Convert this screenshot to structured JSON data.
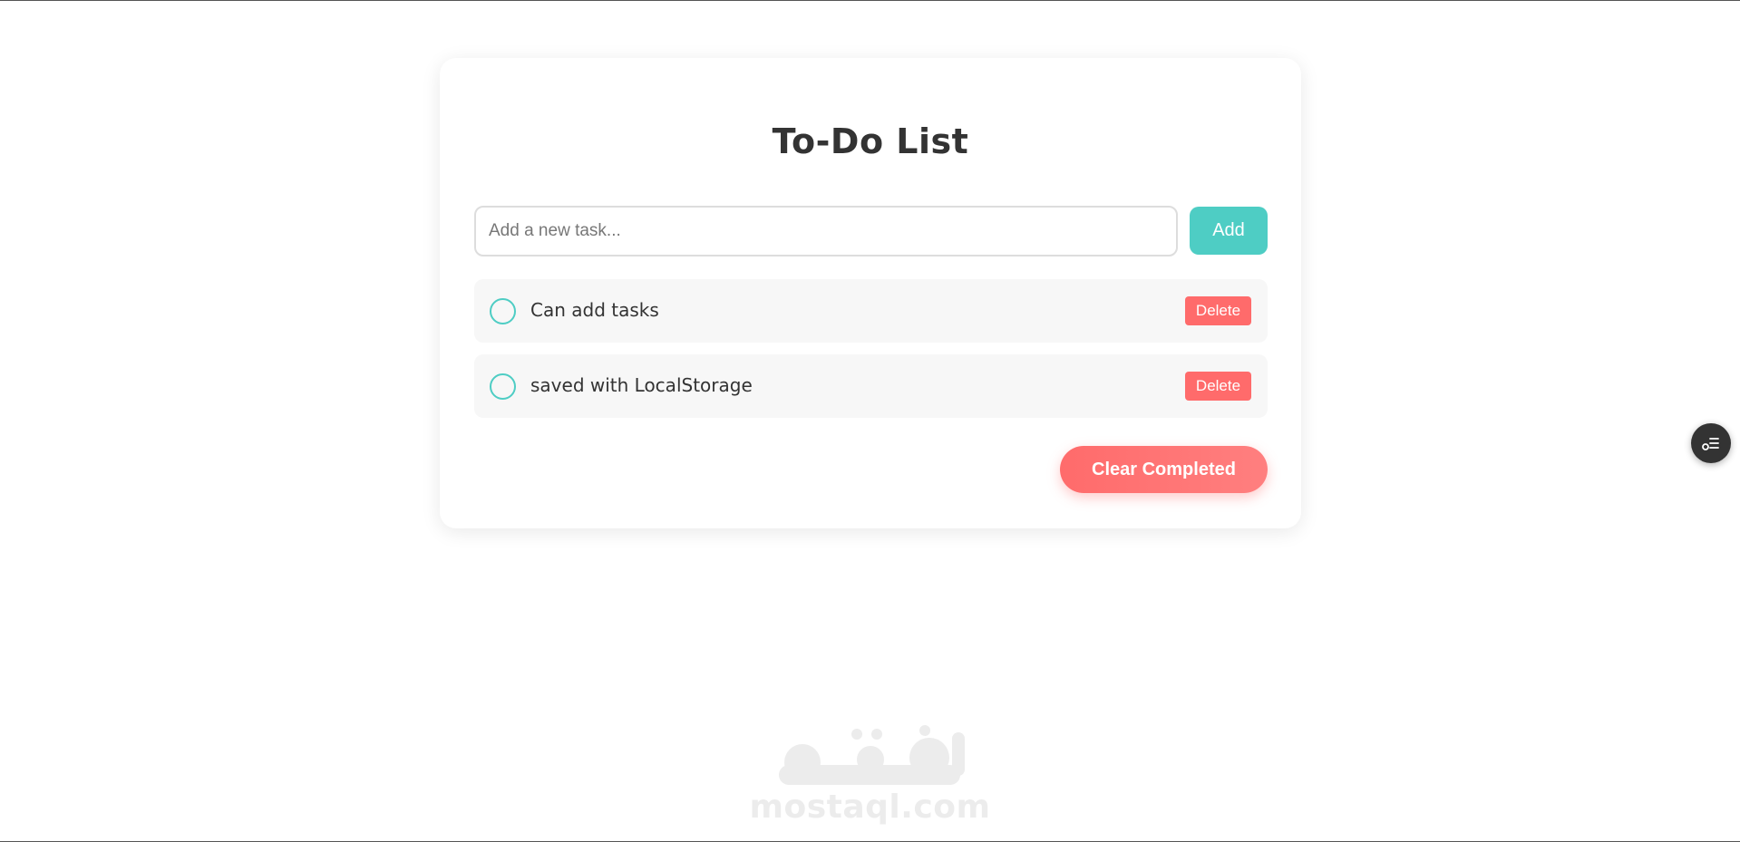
{
  "app": {
    "title": "To-Do List"
  },
  "input": {
    "placeholder": "Add a new task...",
    "value": ""
  },
  "add_button": {
    "label": "Add"
  },
  "tasks": [
    {
      "text": "Can add tasks",
      "completed": false,
      "delete_label": "Delete"
    },
    {
      "text": "saved with LocalStorage",
      "completed": false,
      "delete_label": "Delete"
    }
  ],
  "clear_button": {
    "label": "Clear Completed"
  },
  "watermark": {
    "text": "mostaql.com",
    "logo_text": "مستقل"
  },
  "colors": {
    "accent": "#4ecdc4",
    "danger": "#ff6b6b",
    "title": "#333333",
    "item_bg": "#f7f7f7"
  },
  "icons": {
    "side_button": "list-settings-icon",
    "task_check": "circle-checkbox-icon"
  }
}
